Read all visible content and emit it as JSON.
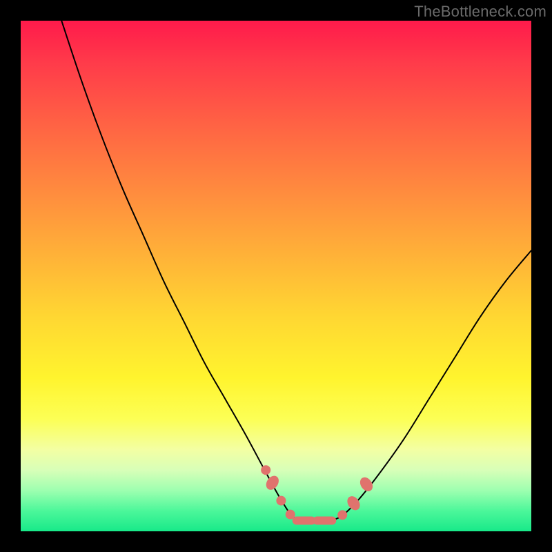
{
  "watermark": "TheBottleneck.com",
  "colors": {
    "frame": "#000000",
    "gradient_top": "#ff1a4b",
    "gradient_bottom": "#18e989",
    "curve": "#000000",
    "marker": "#e0736d"
  },
  "chart_data": {
    "type": "line",
    "title": "",
    "xlabel": "",
    "ylabel": "",
    "xlim": [
      0,
      100
    ],
    "ylim": [
      0,
      100
    ],
    "series": [
      {
        "name": "left-curve",
        "x": [
          8,
          12,
          16,
          20,
          24,
          28,
          32,
          36,
          40,
          44,
          47.5,
          50.5,
          53
        ],
        "y": [
          100,
          88,
          77,
          67,
          58,
          49,
          41,
          33,
          26,
          19,
          12.5,
          7,
          3
        ]
      },
      {
        "name": "bottom-flat",
        "x": [
          53,
          55,
          58,
          61,
          63
        ],
        "y": [
          3,
          2.2,
          2,
          2.2,
          3
        ]
      },
      {
        "name": "right-curve",
        "x": [
          63,
          66,
          70,
          75,
          80,
          85,
          90,
          95,
          100
        ],
        "y": [
          3,
          6,
          11,
          18,
          26,
          34,
          42,
          49,
          55
        ]
      }
    ],
    "markers": [
      {
        "x": 48,
        "y": 12.0,
        "shape": "round"
      },
      {
        "x": 49.3,
        "y": 9.5,
        "shape": "oval"
      },
      {
        "x": 51,
        "y": 6.0,
        "shape": "round"
      },
      {
        "x": 52.8,
        "y": 3.3,
        "shape": "round"
      },
      {
        "x": 55.5,
        "y": 2.1,
        "shape": "bar"
      },
      {
        "x": 59.5,
        "y": 2.1,
        "shape": "bar"
      },
      {
        "x": 63,
        "y": 3.2,
        "shape": "round"
      },
      {
        "x": 65.2,
        "y": 5.5,
        "shape": "oval"
      },
      {
        "x": 67.7,
        "y": 9.2,
        "shape": "oval"
      }
    ]
  }
}
